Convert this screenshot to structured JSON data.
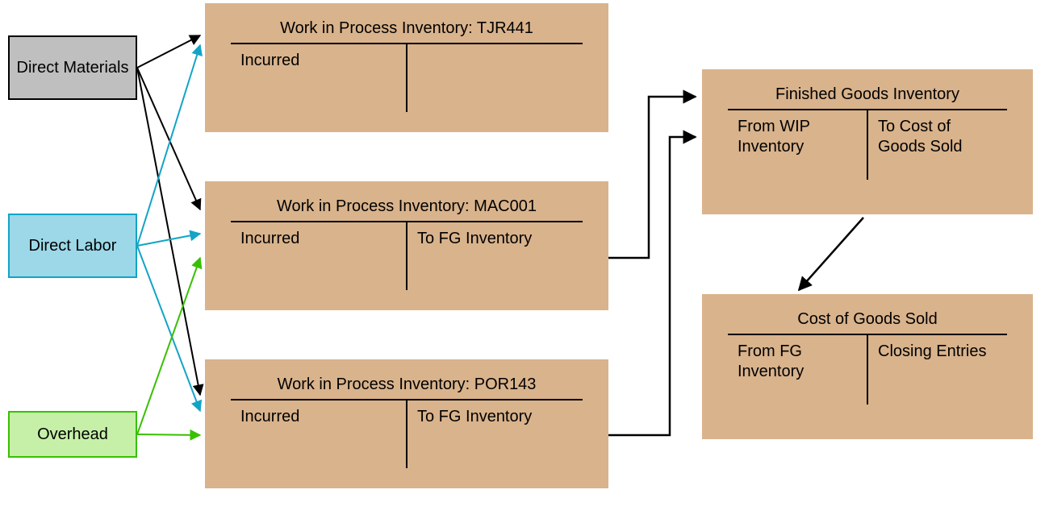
{
  "inputs": {
    "direct_materials": {
      "label": "Direct Materials",
      "fill": "#bfbfbf",
      "stroke": "#000000"
    },
    "direct_labor": {
      "label": "Direct Labor",
      "fill": "#9cd8e8",
      "stroke": "#12a4c6"
    },
    "overhead": {
      "label": "Overhead",
      "fill": "#c6f0a8",
      "stroke": "#38c000"
    }
  },
  "wip": {
    "tjr441": {
      "title": "Work in Process Inventory: TJR441",
      "debit": "Incurred",
      "credit": ""
    },
    "mac001": {
      "title": "Work in Process Inventory: MAC001",
      "debit": "Incurred",
      "credit": "To FG Inventory"
    },
    "por143": {
      "title": "Work in Process Inventory: POR143",
      "debit": "Incurred",
      "credit": "To FG Inventory"
    }
  },
  "fg": {
    "title": "Finished Goods Inventory",
    "debit": "From WIP Inventory",
    "credit": "To Cost of Goods Sold"
  },
  "cogs": {
    "title": "Cost of Goods Sold",
    "debit": "From FG Inventory",
    "credit": "Closing Entries"
  },
  "arrow_colors": {
    "black": "#000000",
    "cyan": "#12a4c6",
    "green": "#38c000"
  }
}
